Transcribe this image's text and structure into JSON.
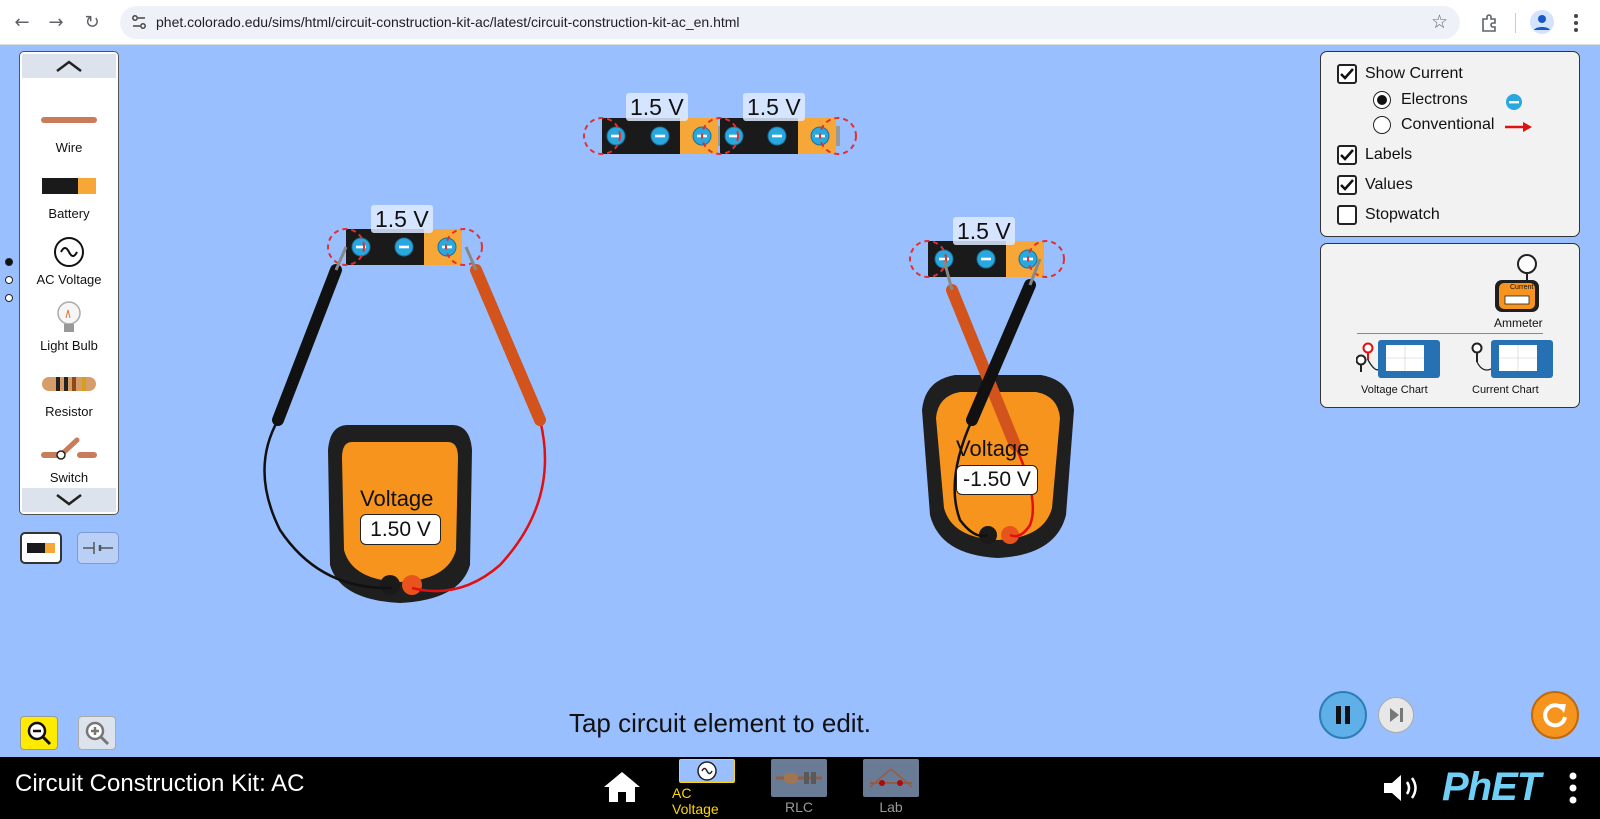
{
  "browser": {
    "url": "phet.colorado.edu/sims/html/circuit-construction-kit-ac/latest/circuit-construction-kit-ac_en.html"
  },
  "toolbox": {
    "items": [
      {
        "label": "Wire",
        "icon": "wire-icon"
      },
      {
        "label": "Battery",
        "icon": "battery-icon"
      },
      {
        "label": "AC Voltage",
        "icon": "ac-voltage-icon"
      },
      {
        "label": "Light Bulb",
        "icon": "light-bulb-icon"
      },
      {
        "label": "Resistor",
        "icon": "resistor-icon"
      },
      {
        "label": "Switch",
        "icon": "switch-icon"
      }
    ]
  },
  "display_panel": {
    "show_current": {
      "label": "Show Current",
      "checked": true
    },
    "electrons": {
      "label": "Electrons",
      "selected": true
    },
    "conventional": {
      "label": "Conventional",
      "selected": false
    },
    "labels": {
      "label": "Labels",
      "checked": true
    },
    "values": {
      "label": "Values",
      "checked": true
    },
    "stopwatch": {
      "label": "Stopwatch",
      "checked": false
    }
  },
  "sensors": {
    "ammeter": {
      "label": "Ammeter",
      "screen": "Current"
    },
    "voltage_chart": {
      "label": "Voltage Chart"
    },
    "current_chart": {
      "label": "Current Chart"
    }
  },
  "circuit": {
    "batteries": [
      {
        "label": "1.5 V"
      },
      {
        "label": "1.5 V"
      },
      {
        "label": "1.5 V"
      },
      {
        "label": "1.5 V"
      }
    ],
    "voltmeters": [
      {
        "title": "Voltage",
        "value": "1.50 V"
      },
      {
        "title": "Voltage",
        "value": "-1.50 V"
      }
    ]
  },
  "hint": "Tap circuit element to edit.",
  "nav": {
    "title": "Circuit Construction Kit: AC",
    "screens": [
      {
        "label": "AC Voltage",
        "active": true
      },
      {
        "label": "RLC",
        "active": false
      },
      {
        "label": "Lab",
        "active": false
      }
    ],
    "logo": "PhET"
  },
  "colors": {
    "play_area": "#99bfff",
    "battery_orange": "#f7a638",
    "meter_orange": "#f7941d",
    "active_screen": "#ffd700",
    "electron": "#29a8e0"
  }
}
